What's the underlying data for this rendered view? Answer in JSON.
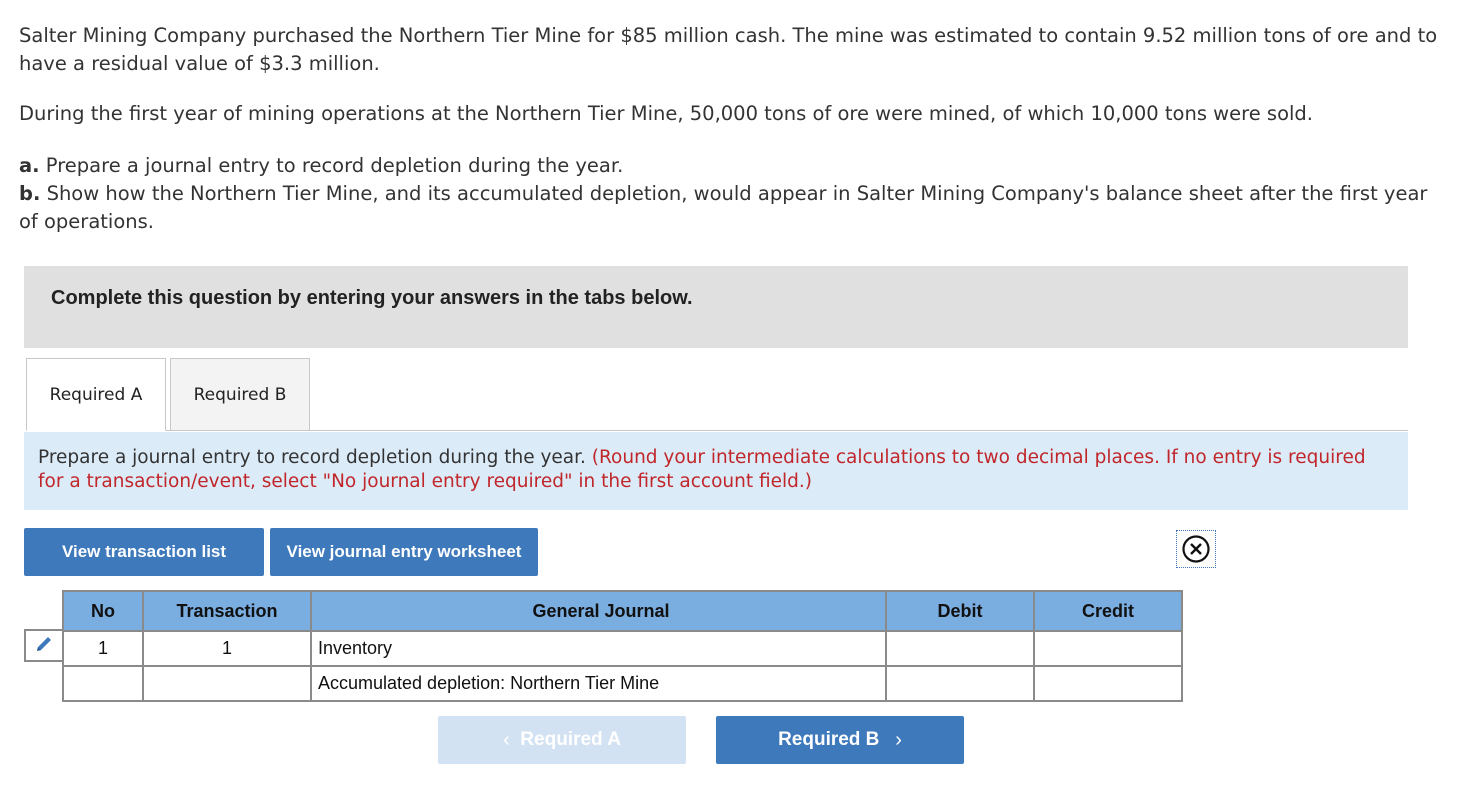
{
  "problem": {
    "p1": "Salter Mining Company purchased the Northern Tier Mine for $85 million cash. The mine was estimated to contain 9.52 million tons of ore and to have a residual value of $3.3 million.",
    "p2": "During the first year of mining operations at the Northern Tier Mine, 50,000 tons of ore were mined, of which 10,000 tons were sold.",
    "a_label": "a.",
    "a_text": " Prepare a journal entry to record depletion during the year.",
    "b_label": "b.",
    "b_text": " Show how the Northern Tier Mine, and its accumulated depletion, would appear in Salter Mining Company's balance sheet after the first year of operations."
  },
  "banner": "Complete this question by entering your answers in the tabs below.",
  "tabs": [
    {
      "label": "Required A",
      "active": true
    },
    {
      "label": "Required B",
      "active": false
    }
  ],
  "instruction": {
    "text": "Prepare a journal entry to record depletion during the year. ",
    "note": "(Round your intermediate calculations to two decimal places. If no entry is required for a transaction/event, select \"No journal entry required\" in the first account field.)"
  },
  "buttons": {
    "view_list": "View transaction list",
    "view_worksheet": "View journal entry worksheet"
  },
  "icons": {
    "close": "close-circle-icon",
    "edit": "pencil-icon"
  },
  "journal": {
    "headers": [
      "No",
      "Transaction",
      "General Journal",
      "Debit",
      "Credit"
    ],
    "rows": [
      {
        "no": "1",
        "transaction": "1",
        "account": "Inventory",
        "debit": "",
        "credit": ""
      },
      {
        "no": "",
        "transaction": "",
        "account": "Accumulated depletion: Northern Tier Mine",
        "debit": "",
        "credit": ""
      }
    ]
  },
  "nav": {
    "prev": "Required A",
    "next": "Required B",
    "prev_enabled": false
  },
  "colors": {
    "button_blue": "#3e79bb",
    "header_blue": "#7aade0",
    "instruction_bg": "#dcebf8",
    "note_red": "#c0262a"
  }
}
